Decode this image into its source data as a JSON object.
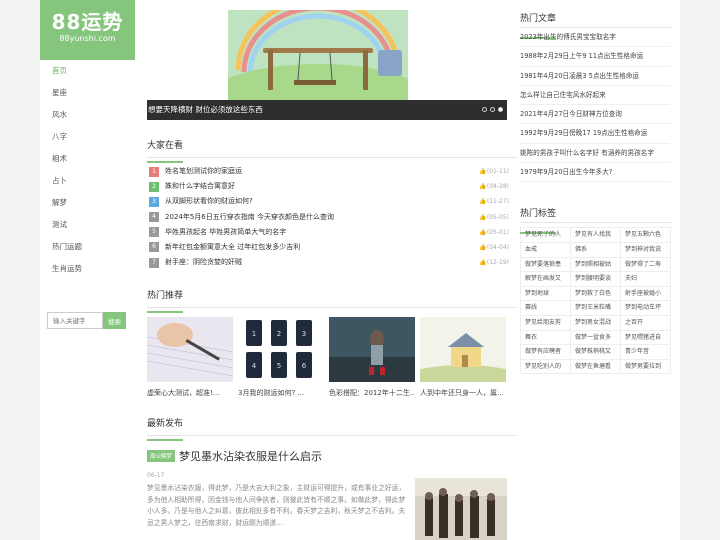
{
  "logo": {
    "main": "88运势",
    "sub": "88yunshi.com"
  },
  "nav": [
    "首页",
    "星座",
    "风水",
    "八字",
    "相术",
    "占卜",
    "解梦",
    "测试",
    "热门运题",
    "生肖运势"
  ],
  "search": {
    "placeholder": "输入关键字",
    "button": "搜索"
  },
  "banner": {
    "caption": "想要天降横财 财位必须放这些东西"
  },
  "popular": {
    "title": "大家在看",
    "items": [
      {
        "rank": "1",
        "title": "姓名笔划测试你的家庭运",
        "date": "01-11"
      },
      {
        "rank": "2",
        "title": "姝和什么字结合寓意好",
        "date": "04-28"
      },
      {
        "rank": "3",
        "title": "从双脚形状看你的财运如何?",
        "date": "11-27"
      },
      {
        "rank": "4",
        "title": "2024年5月6日五行穿衣指南 今天穿衣颜色是什么查询",
        "date": "05-05"
      },
      {
        "rank": "5",
        "title": "毕姓男孩起名 毕姓男孩简单大气的名字",
        "date": "05-01"
      },
      {
        "rank": "6",
        "title": "新年红包金额寓意大全 过年红包发多少吉利",
        "date": "04-04"
      },
      {
        "rank": "7",
        "title": "射手座：阴险贪婪的奸贼",
        "date": "12-19"
      }
    ]
  },
  "hot_recs": {
    "title": "热门推荐",
    "items": [
      {
        "caption": "虚荣心大测试，超准!..."
      },
      {
        "caption": "3月我的财运如何? ..."
      },
      {
        "caption": "色彩搭配：2012年十二生..."
      },
      {
        "caption": "人到中年还只身一人，属..."
      }
    ]
  },
  "latest": {
    "title": "最新发布",
    "category": "周公解梦",
    "post_title": "梦见墨水沾染衣服是什么启示",
    "date": "06-17",
    "excerpt": "梦见墨水沾染衣服，得此梦，乃是大吉大利之象，主财运可得提升，或有事业之好运，多为他人相助所得，因金钱与他人间争执者，则彼此皆有不顺之事。如做此梦，得此梦小人多，乃是与他人之纠葛，彼此相处多有不利。春天梦之吉利，秋天梦之不吉利。夫忌之男人梦之，往西南求财，财运颇为顺遂..."
  },
  "hot_articles": {
    "title": "热门文章",
    "items": [
      "2023年出生的傅氏男宝宝取名字",
      "1988年2月29日上午9 11点出生性格命运",
      "1981年4月20日凌晨3 5点出生性格命运",
      "怎么样让自己住宅风水好起来",
      "2021年4月27日今日财神方位查询",
      "1992年9月29日傍晚17 19点出生性格命运",
      "姚陈的男孩子叫什么名字好 有涵养的男孩名字",
      "1979年9月20日出生今年多大?"
    ]
  },
  "tags": {
    "title": "热门标签",
    "items": [
      "梦见死了的人",
      "梦见有人找我",
      "梦见五颗六色",
      "血戒",
      "佛系",
      "梦到神对我说",
      "做梦要落狼患",
      "梦到照相被姑",
      "做梦得了二寿",
      "解梦在画发又",
      "梦到腰明要谈",
      "夫妇",
      "梦到地球",
      "梦到救了白色",
      "射手座被婚小",
      "赛线",
      "梦到王米粒嘴",
      "梦到电动车坏",
      "梦见给朋友剪",
      "梦到男女混战",
      "之否开",
      "舞衣",
      "做梦一盆食多",
      "梦见喂猪进自",
      "做梦有应聘者",
      "做梦株梢桃又",
      "青少年音",
      "梦见吃别人的",
      "做梦在鱼塘看",
      "做梦男要拉到"
    ]
  }
}
